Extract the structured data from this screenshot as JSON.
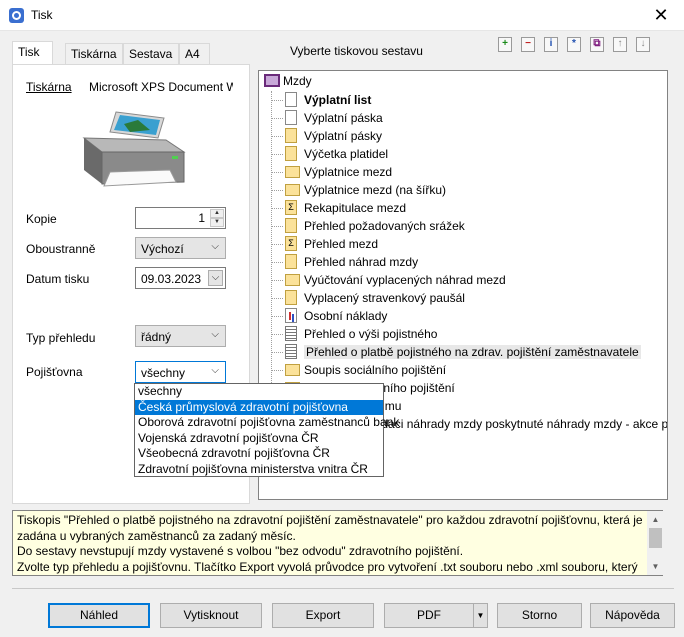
{
  "window": {
    "title": "Tisk",
    "close_glyph": "✕"
  },
  "tabs": [
    "Tisk",
    "Tiskárna",
    "Sestava",
    "A4"
  ],
  "left": {
    "printer_label": "Tiskárna",
    "printer_name": "Microsoft XPS Document W",
    "copies_label": "Kopie",
    "copies_value": "1",
    "duplex_label": "Oboustranně",
    "duplex_value": "Výchozí",
    "date_label": "Datum tisku",
    "date_value": "09.03.2023",
    "type_label": "Typ přehledu",
    "type_value": "řádný",
    "insurer_label": "Pojišťovna",
    "insurer_value": "všechny"
  },
  "insurer_options": [
    "všechny",
    "Česká průmyslová zdravotní pojišťovna",
    "Oborová zdravotní pojišťovna zaměstnanců bank",
    "Vojenská zdravotní pojišťovna ČR",
    "Všeobecná zdravotní pojišťovna ČR",
    "Zdravotní pojišťovna ministerstva vnitra ČR"
  ],
  "insurer_selected_index": 1,
  "right": {
    "caption": "Vyberte tiskovou sestavu",
    "toolbar_icons": [
      "add-icon",
      "remove-icon",
      "info-icon",
      "star-icon",
      "copy-icon",
      "move-up-icon",
      "move-down-icon"
    ],
    "tree_root": "Mzdy",
    "tree_items": [
      "Výplatní list",
      "Výplatní páska",
      "Výplatní pásky",
      "Výčetka platidel",
      "Výplatnice mezd",
      "Výplatnice mezd (na šířku)",
      "Rekapitulace mezd",
      "Přehled požadovaných srážek",
      "Přehled mezd",
      "Přehled náhrad mzdy",
      "Vyúčtování vyplacených náhrad mezd",
      "Vyplacený stravenkový paušál",
      "Osobní náklady",
      "Přehled o výši pojistného",
      "Přehled o platbě pojistného na zdrav. pojištění zaměstnavatele",
      "Soupis sociálního pojištění",
      "Soupis zdravotního pojištění",
      "Potvrzení o příjmu",
      "Žádost o refundaci náhrady mzdy poskytnuté náhrady mzdy - akce pro děti a mládež"
    ]
  },
  "description": [
    "Tiskopis \"Přehled o platbě pojistného na zdravotní pojištění zaměstnavatele\" pro každou zdravotní pojišťovnu, která je zadána u vybraných zaměstnanců za zadaný měsíc.",
    "Do sestavy nevstupují mzdy vystavené s volbou \"bez odvodu\" zdravotního pojištění.",
    "Zvolte typ přehledu a pojišťovnu. Tlačítko Export vyvolá průvodce pro vytvoření .txt souboru nebo .xml souboru, který"
  ],
  "buttons": {
    "preview": "Náhled",
    "print": "Vytisknout",
    "export": "Export",
    "pdf": "PDF",
    "cancel": "Storno",
    "help": "Nápověda"
  }
}
